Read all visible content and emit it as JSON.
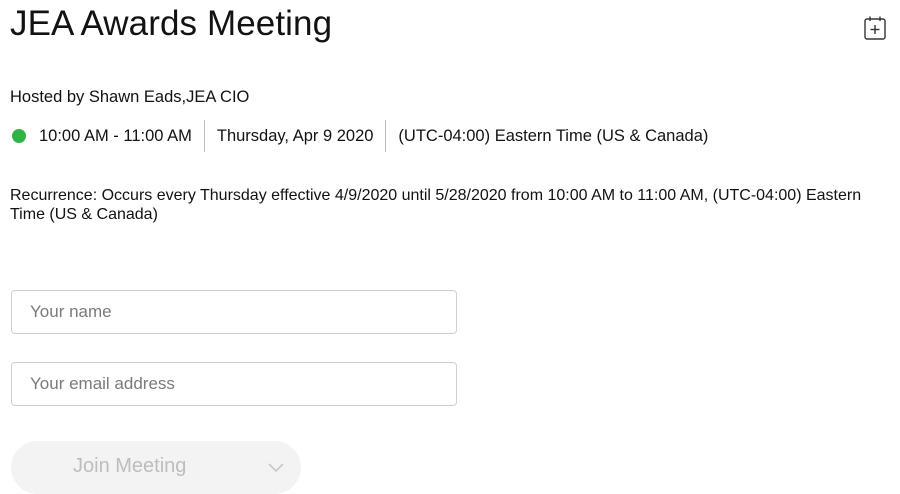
{
  "meeting": {
    "title": "JEA Awards Meeting",
    "host": "Hosted by Shawn Eads,JEA CIO",
    "time": "10:00 AM - 11:00 AM",
    "date": "Thursday, Apr 9 2020",
    "timezone": "(UTC-04:00) Eastern Time (US & Canada)",
    "recurrence": "Recurrence: Occurs every Thursday effective 4/9/2020 until 5/28/2020 from 10:00 AM to 11:00 AM, (UTC-04:00) Eastern Time (US & Canada)",
    "status_color": "#2fb344"
  },
  "form": {
    "name_placeholder": "Your name",
    "name_value": "",
    "email_placeholder": "Your email address",
    "email_value": "",
    "join_label": "Join Meeting",
    "join_enabled": false
  },
  "icons": {
    "add_to_calendar": "calendar-add-icon",
    "join_menu": "chevron-down-icon"
  }
}
